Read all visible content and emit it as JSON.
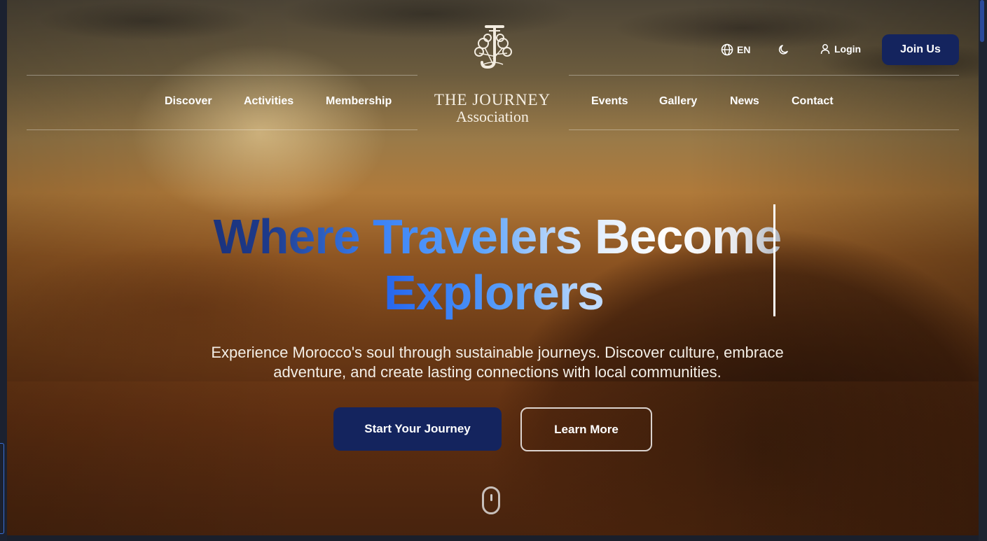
{
  "brand": {
    "name_line1": "THE JOURNEY",
    "name_line2": "Association"
  },
  "nav": {
    "left": [
      "Discover",
      "Activities",
      "Membership"
    ],
    "right": [
      "Events",
      "Gallery",
      "News",
      "Contact"
    ]
  },
  "utility": {
    "language": "EN",
    "login": "Login",
    "join": "Join Us"
  },
  "hero": {
    "headline_line1": "Where Travelers Become",
    "headline_line2": "Explorers",
    "subtitle_line1": "Experience Morocco's soul through sustainable journeys. Discover culture, embrace",
    "subtitle_line2": "adventure, and create lasting connections with local communities.",
    "primary_cta": "Start Your Journey",
    "secondary_cta": "Learn More"
  },
  "icons": {
    "language": "globe-icon",
    "theme": "moon-icon",
    "login": "user-icon",
    "scroll": "mouse-scroll-icon"
  },
  "colors": {
    "brand_navy": "#14245e",
    "headline_blue": "#3b82f6"
  }
}
